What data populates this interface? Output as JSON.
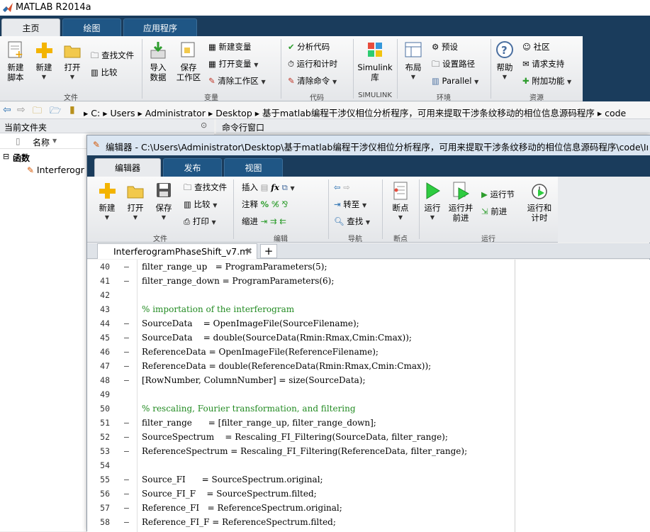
{
  "app": {
    "title": "MATLAB R2014a"
  },
  "main_tabs": [
    "主页",
    "绘图",
    "应用程序"
  ],
  "ribbon": {
    "new_script": "新建\n脚本",
    "new": "新建",
    "open": "打开",
    "find_files": "查找文件",
    "compare": "比较",
    "import_data": "导入\n数据",
    "save_workspace": "保存\n工作区",
    "new_variable": "新建变量",
    "open_variable": "打开变量",
    "clear_workspace": "清除工作区",
    "analyze_code": "分析代码",
    "run_and_time": "运行和计时",
    "clear_commands": "清除命令",
    "simulink": "Simulink\n库",
    "layout": "布局",
    "preferences": "预设",
    "set_path": "设置路径",
    "parallel": "Parallel",
    "help": "帮助",
    "community": "社区",
    "request_support": "请求支持",
    "add_ons": "附加功能",
    "groups": {
      "file": "文件",
      "variable": "变量",
      "code": "代码",
      "simulink": "SIMULINK",
      "environment": "环境",
      "resources": "资源"
    }
  },
  "address": {
    "crumbs": [
      "C:",
      "Users",
      "Administrator",
      "Desktop",
      "基于matlab编程干涉仪相位分析程序，可用来提取干涉条纹移动的相位信息源码程序",
      "code"
    ]
  },
  "current_folder": {
    "title": "当前文件夹",
    "column_name": "名称",
    "group_label": "函数",
    "file": "Interferogr"
  },
  "command_window": {
    "title": "命令行窗口"
  },
  "editor": {
    "title": "编辑器 - C:\\Users\\Administrator\\Desktop\\基于matlab编程干涉仪相位分析程序，可用来提取干涉条纹移动的相位信息源码程序\\code\\Interfe",
    "tabs": [
      "编辑器",
      "发布",
      "视图"
    ],
    "ribbon": {
      "new": "新建",
      "open": "打开",
      "save": "保存",
      "find_files": "查找文件",
      "compare": "比较",
      "print": "打印",
      "insert": "插入",
      "comment": "注释",
      "indent": "缩进",
      "goto": "转至",
      "find": "查找",
      "breakpoints": "断点",
      "run": "运行",
      "run_advance": "运行并\n前进",
      "run_section": "运行节",
      "advance": "前进",
      "run_and_time": "运行和\n计时",
      "groups": {
        "file": "文件",
        "edit": "编辑",
        "navigate": "导航",
        "breakpoints": "断点",
        "run": "运行"
      }
    },
    "file_tab": "InterferogramPhaseShift_v7.m",
    "lines": [
      {
        "n": "40",
        "dash": true,
        "text": "filter_range_up   = ProgramParameters(5);",
        "comment": false
      },
      {
        "n": "41",
        "dash": true,
        "text": "filter_range_down = ProgramParameters(6);",
        "comment": false
      },
      {
        "n": "42",
        "dash": false,
        "text": "",
        "comment": false
      },
      {
        "n": "43",
        "dash": false,
        "text": "% importation of the interferogram",
        "comment": true
      },
      {
        "n": "44",
        "dash": true,
        "text": "SourceData    = OpenImageFile(SourceFilename);",
        "comment": false
      },
      {
        "n": "45",
        "dash": true,
        "text": "SourceData    = double(SourceData(Rmin:Rmax,Cmin:Cmax));",
        "comment": false
      },
      {
        "n": "46",
        "dash": true,
        "text": "ReferenceData = OpenImageFile(ReferenceFilename);",
        "comment": false
      },
      {
        "n": "47",
        "dash": true,
        "text": "ReferenceData = double(ReferenceData(Rmin:Rmax,Cmin:Cmax));",
        "comment": false
      },
      {
        "n": "48",
        "dash": true,
        "text": "[RowNumber, ColumnNumber] = size(SourceData);",
        "comment": false
      },
      {
        "n": "49",
        "dash": false,
        "text": "",
        "comment": false
      },
      {
        "n": "50",
        "dash": false,
        "text": "% rescaling, Fourier transformation, and filtering",
        "comment": true
      },
      {
        "n": "51",
        "dash": true,
        "text": "filter_range      = [filter_range_up, filter_range_down];",
        "comment": false
      },
      {
        "n": "52",
        "dash": true,
        "text": "SourceSpectrum    = Rescaling_FI_Filtering(SourceData, filter_range);",
        "comment": false
      },
      {
        "n": "53",
        "dash": true,
        "text": "ReferenceSpectrum = Rescaling_FI_Filtering(ReferenceData, filter_range);",
        "comment": false
      },
      {
        "n": "54",
        "dash": false,
        "text": "",
        "comment": false
      },
      {
        "n": "55",
        "dash": true,
        "text": "Source_FI      = SourceSpectrum.original;",
        "comment": false
      },
      {
        "n": "56",
        "dash": true,
        "text": "Source_FI_F    = SourceSpectrum.filted;",
        "comment": false
      },
      {
        "n": "57",
        "dash": true,
        "text": "Reference_FI   = ReferenceSpectrum.original;",
        "comment": false
      },
      {
        "n": "58",
        "dash": true,
        "text": "Reference_FI_F = ReferenceSpectrum.filted;",
        "comment": false
      }
    ]
  },
  "colors": {
    "ribbon_dark": "#1a3c5c",
    "comment": "#228b22",
    "active_tab": "#e8eaed"
  }
}
